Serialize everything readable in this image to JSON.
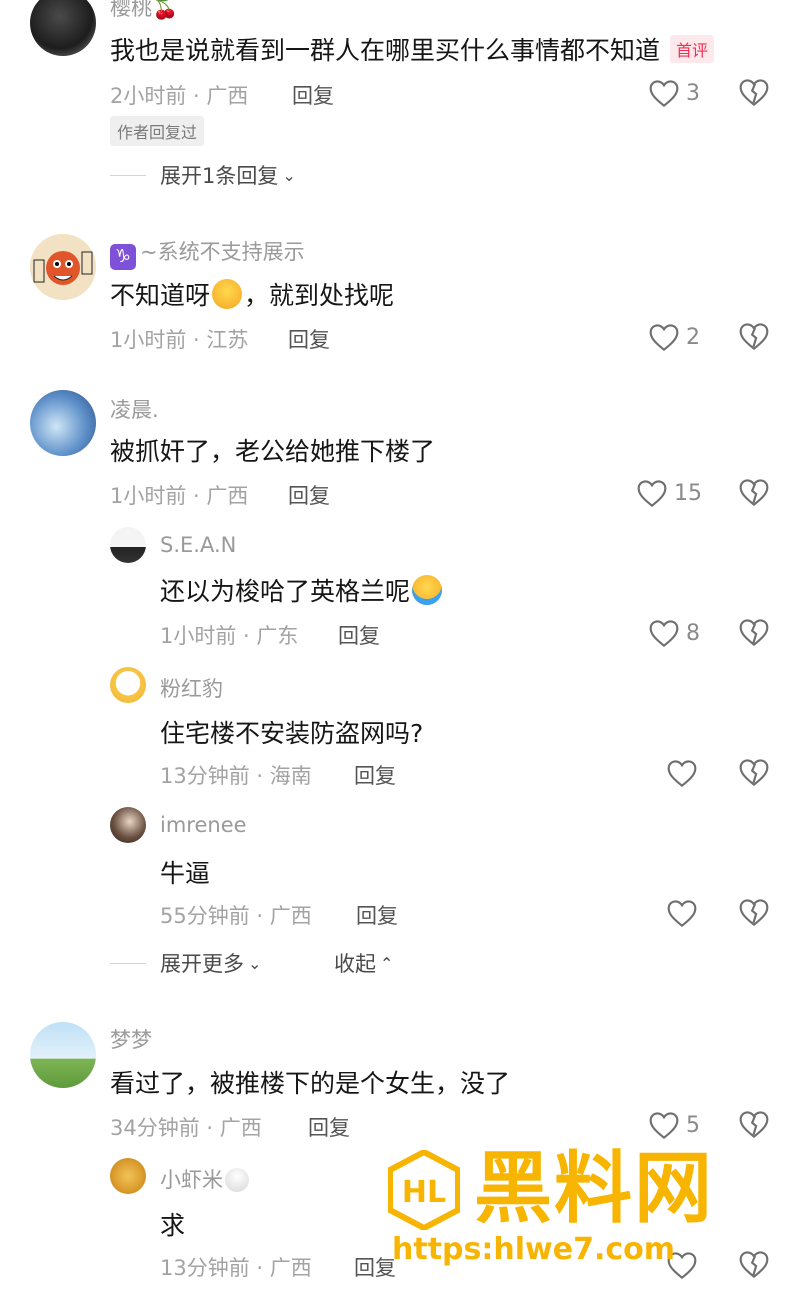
{
  "comments": [
    {
      "username": "樱桃",
      "username_emoji": "🍒",
      "text": "我也是说就看到一群人在哪里买什么事情都不知道",
      "badge": "首评",
      "meta": "2小时前 · 广西",
      "reply": "回复",
      "likes": "3",
      "author_replied": "作者回复过",
      "expand": "展开1条回复"
    },
    {
      "username": "~系统不支持展示",
      "username_symbol": "♑",
      "text_before": "不知道呀",
      "text_after": "，就到处找呢",
      "meta": "1小时前 · 江苏",
      "reply": "回复",
      "likes": "2"
    },
    {
      "username": "凌晨.",
      "text": "被抓奸了，老公给她推下楼了",
      "meta": "1小时前 · 广西",
      "reply": "回复",
      "likes": "15",
      "replies": [
        {
          "username": "S.E.A.N",
          "text": "还以为梭哈了英格兰呢",
          "meta": "1小时前 · 广东",
          "reply": "回复",
          "likes": "8"
        },
        {
          "username": "粉红豹",
          "text": "住宅楼不安装防盗网吗?",
          "meta": "13分钟前 · 海南",
          "reply": "回复",
          "likes": ""
        },
        {
          "username": "imrenee",
          "text": "牛逼",
          "meta": "55分钟前 · 广西",
          "reply": "回复",
          "likes": ""
        }
      ],
      "expand_more": "展开更多",
      "collapse": "收起"
    },
    {
      "username": "梦梦",
      "text": "看过了，被推楼下的是个女生，没了",
      "meta": "34分钟前 · 广西",
      "reply": "回复",
      "likes": "5",
      "replies": [
        {
          "username": "小虾米",
          "text": "求",
          "meta": "13分钟前 · 广西",
          "reply": "回复",
          "likes": ""
        }
      ]
    }
  ],
  "watermark": {
    "title": "黑料网",
    "url": "https:hlwe7.com",
    "logo_text": "HL"
  },
  "colors": {
    "accent": "#ef2f55",
    "watermark": "#f7b400",
    "muted": "#a3a3a3"
  }
}
